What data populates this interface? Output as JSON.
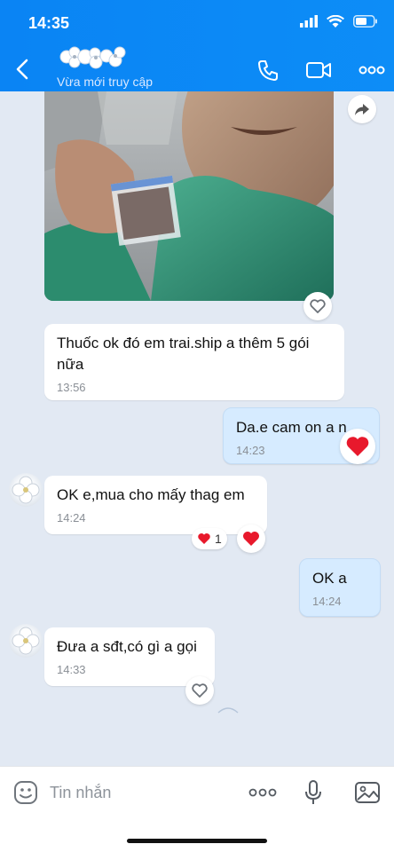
{
  "status_bar": {
    "time": "14:35"
  },
  "header": {
    "contact_status": "Vừa mới truy cập",
    "icons": [
      "back-icon",
      "phone-icon",
      "video-call-icon",
      "more-icon"
    ]
  },
  "messages": [
    {
      "id": "m1",
      "sender": "them",
      "text": "Thuốc ok đó em trai.ship a thêm 5 gói nữa",
      "time": "13:56"
    },
    {
      "id": "m2",
      "sender": "me",
      "text": "Da.e cam on a n",
      "time": "14:23",
      "reaction": "heart"
    },
    {
      "id": "m3",
      "sender": "them",
      "text": "OK e,mua cho mấy thag em",
      "time": "14:24",
      "reaction_count": "1"
    },
    {
      "id": "m4",
      "sender": "me",
      "text": "OK a",
      "time": "14:24"
    },
    {
      "id": "m5",
      "sender": "them",
      "text": "Đưa a sđt,có gì a gọi",
      "time": "14:33"
    }
  ],
  "input": {
    "placeholder": "Tin nhắn"
  },
  "colors": {
    "header": "#0a84f4",
    "mine_bubble": "#d6ebff",
    "background": "#e2e9f3",
    "heart": "#e8192c"
  }
}
